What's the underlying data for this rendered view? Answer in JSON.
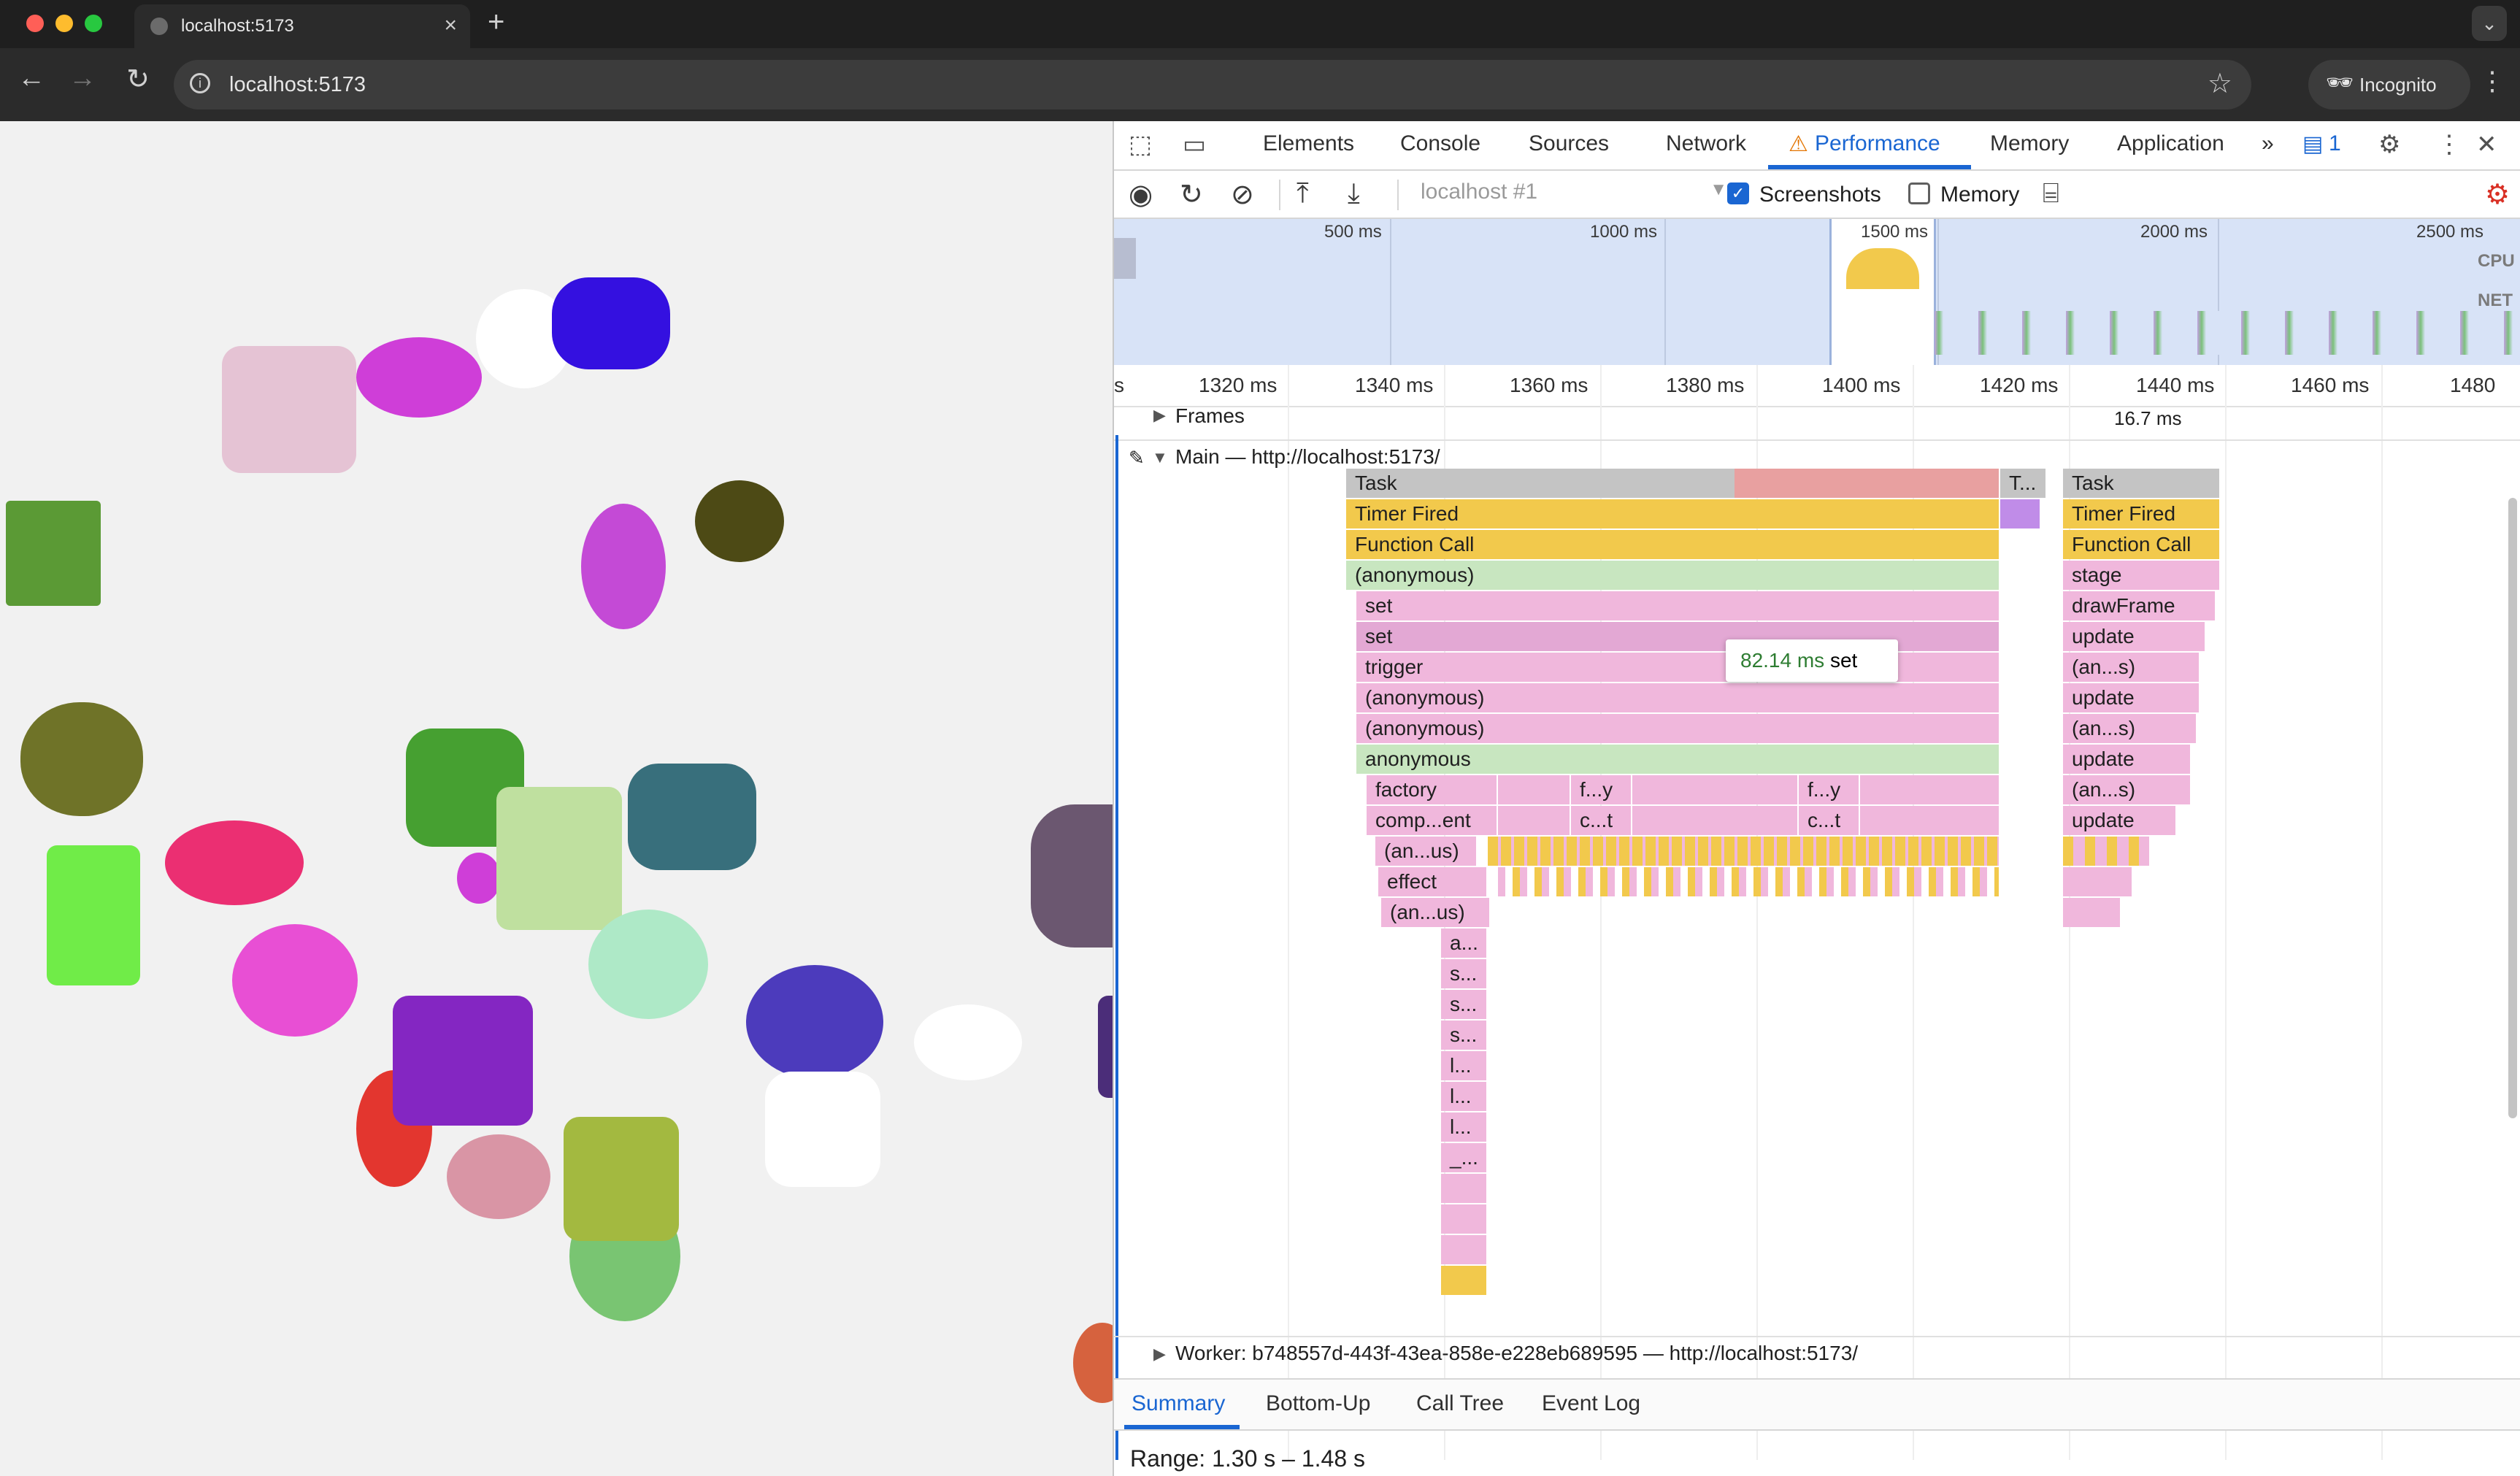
{
  "browser": {
    "tab_title": "localhost:5173",
    "url": "localhost:5173",
    "incognito_label": "Incognito"
  },
  "devtools": {
    "tabs": [
      "Elements",
      "Console",
      "Sources",
      "Network",
      "Performance",
      "Memory",
      "Application"
    ],
    "active_tab": "Performance",
    "issues_count": "1",
    "toolbar": {
      "target": "localhost #1",
      "screenshots_label": "Screenshots",
      "screenshots_checked": true,
      "memory_label": "Memory",
      "memory_checked": false
    },
    "overview": {
      "ticks": [
        "500 ms",
        "1000 ms",
        "1500 ms",
        "2000 ms",
        "2500 ms"
      ],
      "cpu_label": "CPU",
      "net_label": "NET"
    },
    "ruler": {
      "ticks": [
        "s",
        "1320 ms",
        "1340 ms",
        "1360 ms",
        "1380 ms",
        "1400 ms",
        "1420 ms",
        "1440 ms",
        "1460 ms",
        "1480"
      ]
    },
    "frames": {
      "label": "Frames",
      "frame_time": "16.7 ms"
    },
    "main_track": {
      "label": "Main — http://localhost:5173/",
      "left_stack": [
        "Task",
        "Timer Fired",
        "Function Call",
        "(anonymous)",
        "set",
        "set",
        "trigger",
        "(anonymous)",
        "(anonymous)",
        "anonymous"
      ],
      "left_sub": [
        "factory",
        "comp...ent",
        "(an...us)",
        "effect",
        "(an...us)",
        "a...",
        "s...",
        "s...",
        "s...",
        "l...",
        "l...",
        "l...",
        "_..."
      ],
      "mid_sub_1": [
        "f...y",
        "c...t"
      ],
      "mid_sub_2": [
        "f...y",
        "c...t"
      ],
      "small_task": "T...",
      "right_stack": [
        "Task",
        "Timer Fired",
        "Function Call",
        "stage",
        "drawFrame",
        "update",
        "(an...s)",
        "update",
        "(an...s)",
        "update",
        "(an...s)",
        "update"
      ]
    },
    "tooltip": {
      "duration": "82.14 ms",
      "name": "set"
    },
    "worker_track": {
      "label": "Worker: b748557d-443f-43ea-858e-e228eb689595 — http://localhost:5173/"
    },
    "bottom_tabs": [
      "Summary",
      "Bottom-Up",
      "Call Tree",
      "Event Log"
    ],
    "active_bottom_tab": "Summary",
    "range": "Range: 1.30 s – 1.48 s"
  },
  "page_shapes": {
    "colors": [
      "#e5c3d4",
      "#cf3ed8",
      "#ffffff",
      "#3410e0",
      "#5b9a35",
      "#4d4a15",
      "#c44ad6",
      "#6f7328",
      "#eb2f72",
      "#70ec48",
      "#46a031",
      "#bfe09f",
      "#386f7c",
      "#e84fd4",
      "#aee9c7",
      "#4c3bbc",
      "#ffffff",
      "#6b5770",
      "#e3362f",
      "#8426c2",
      "#d995a5",
      "#a3b940",
      "#79c572",
      "#ffffff",
      "#d6623e",
      "#4b2d79"
    ]
  }
}
